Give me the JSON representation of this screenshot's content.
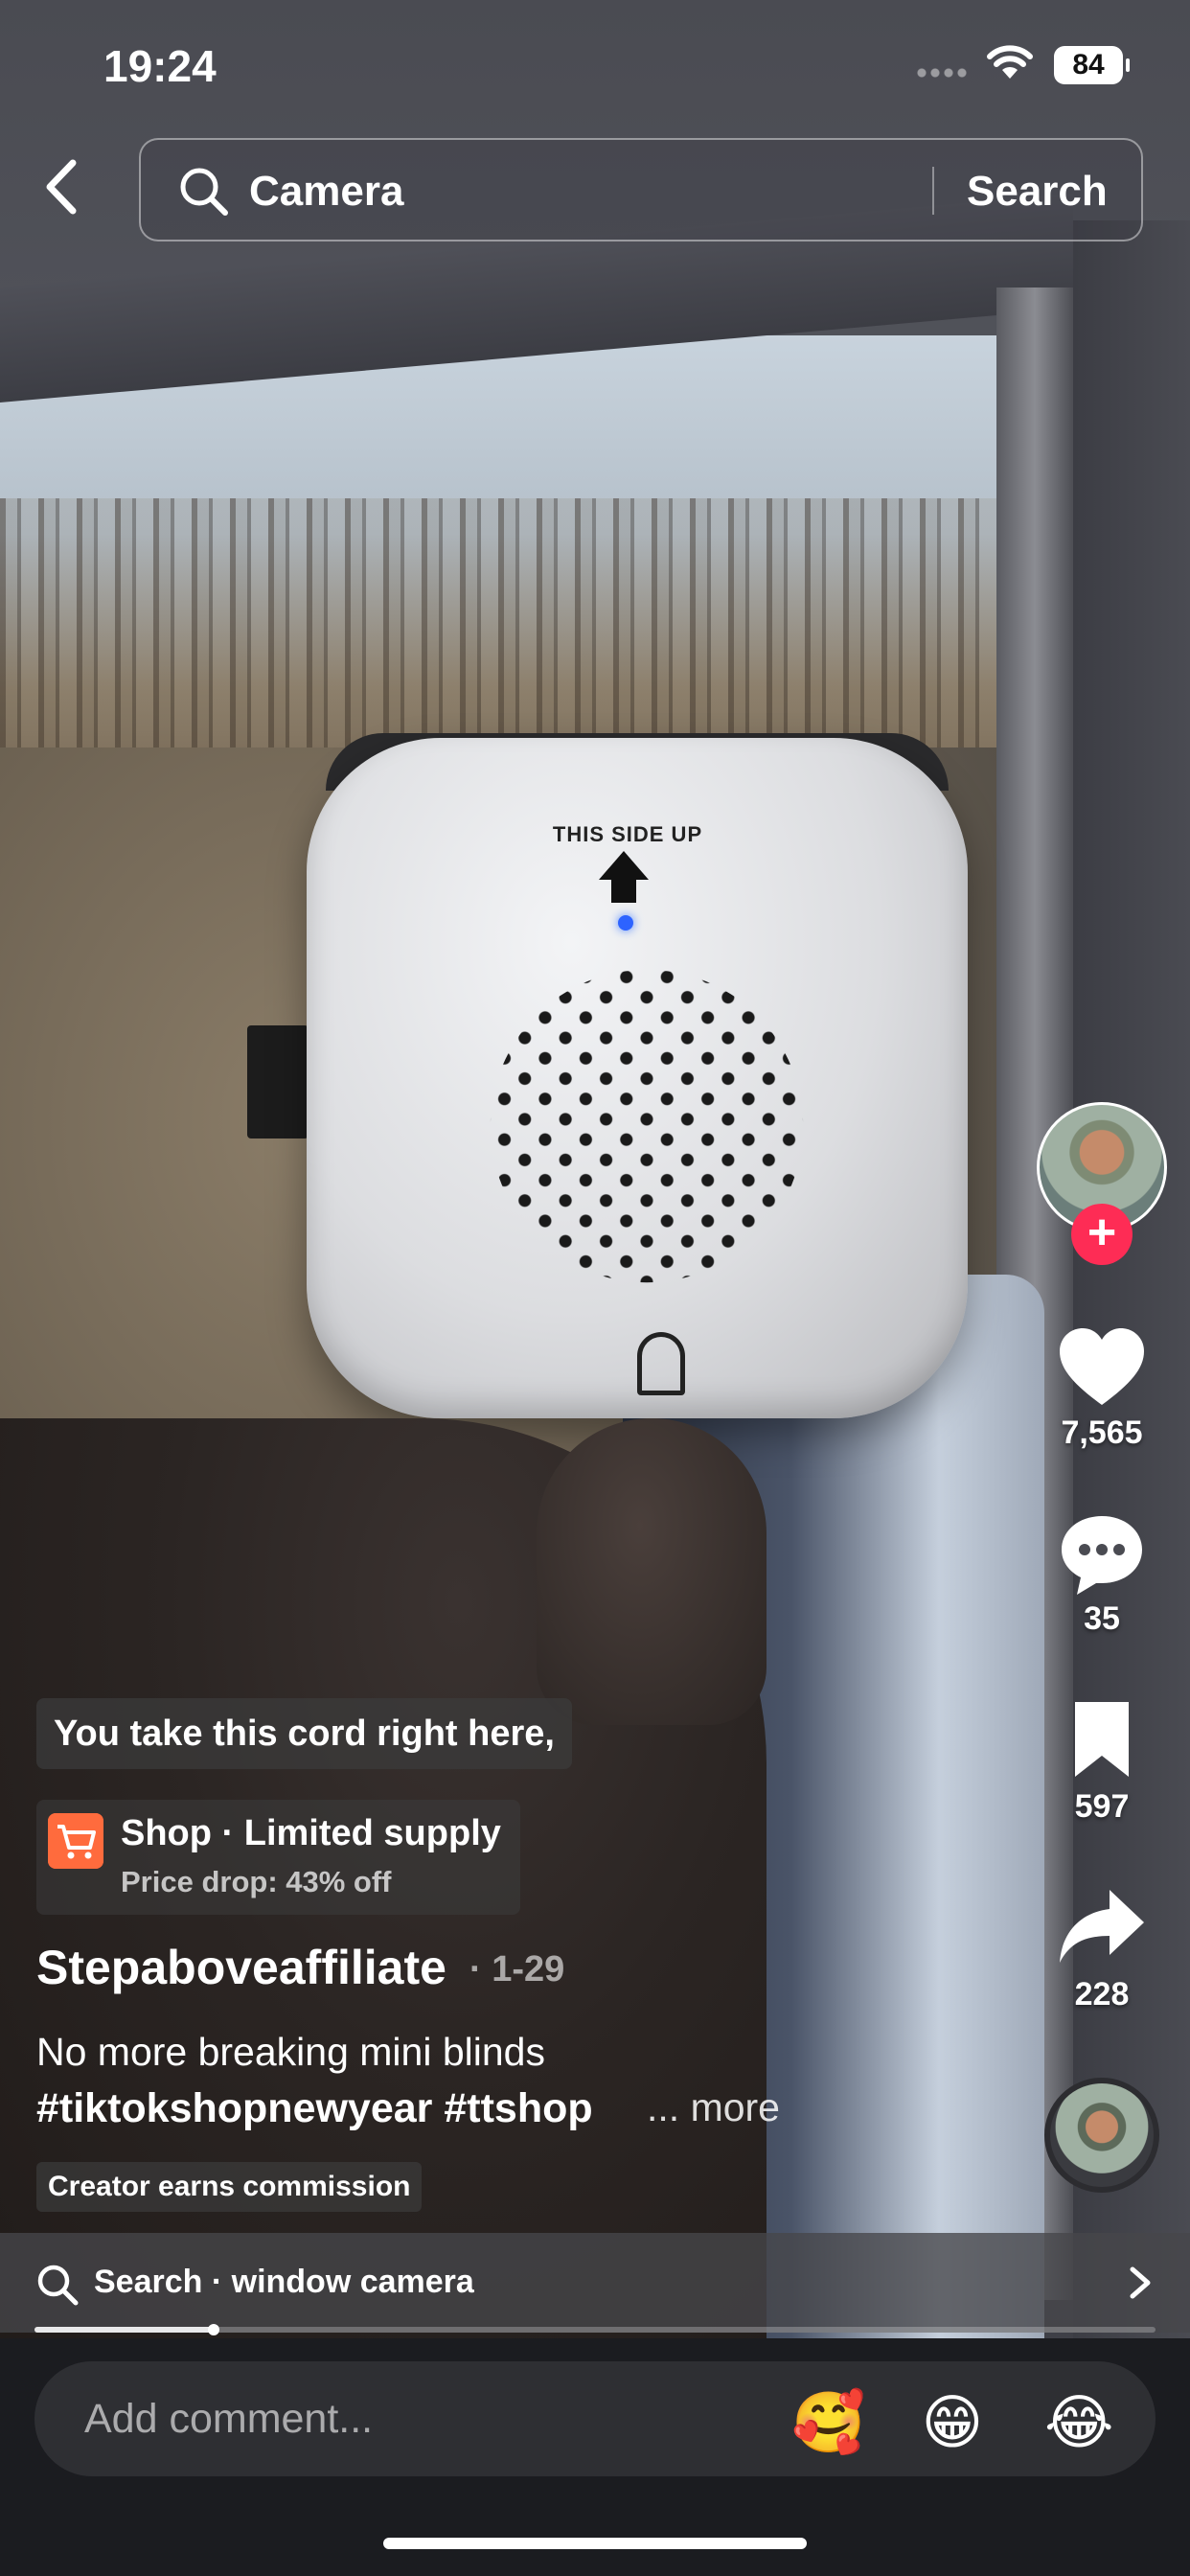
{
  "status_bar": {
    "time": "19:24",
    "battery": "84"
  },
  "search": {
    "query": "Camera",
    "button_label": "Search"
  },
  "video": {
    "product_label": "THIS SIDE UP"
  },
  "side_actions": {
    "likes": "7,565",
    "comments": "35",
    "bookmarks": "597",
    "shares": "228"
  },
  "caption": "You take this cord right here,",
  "shop": {
    "title": "Shop · Limited supply",
    "subtitle": "Price drop: 43% off"
  },
  "post": {
    "username": "Stepaboveaffiliate",
    "date": "· 1-29",
    "description": "No more breaking mini blinds",
    "hashtags": "#tiktokshopnewyear #ttshop",
    "more_label": "... more",
    "badge": "Creator earns commission"
  },
  "search_suggestion": "Search · window camera",
  "playback_progress": 0.16,
  "comment": {
    "placeholder": "Add comment...",
    "emojis": [
      "🥰",
      "😁",
      "😂"
    ]
  },
  "colors": {
    "accent": "#fe2c55",
    "shop_icon": "#ff6b3d",
    "background": "#1b1c20"
  }
}
